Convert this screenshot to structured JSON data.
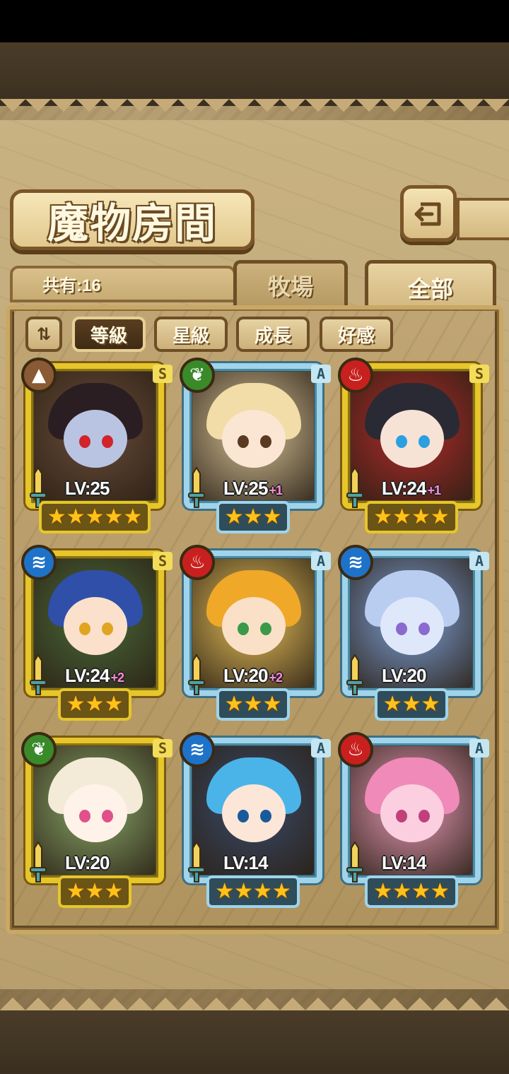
{
  "header": {
    "title": "魔物房間",
    "back_icon": "back-return-icon"
  },
  "collection": {
    "count_label": "共有:16"
  },
  "tabs": [
    {
      "label": "牧場",
      "selected": false
    },
    {
      "label": "全部",
      "selected": true
    }
  ],
  "sort": {
    "toggle_icon": "sort-order-icon",
    "toggle_label": "⇅",
    "options": [
      {
        "label": "等級",
        "active": true
      },
      {
        "label": "星級",
        "active": false
      },
      {
        "label": "成長",
        "active": false
      },
      {
        "label": "好感",
        "active": false
      }
    ]
  },
  "cards": [
    {
      "rank": "S",
      "element": "earth",
      "level": "LV:25",
      "plus": "",
      "stars": "★★★★★",
      "star_count": 5,
      "hair": "#2a1e22",
      "skin": "#b9c4e2",
      "eye": "#d2242a",
      "bg": "#6a4c3a"
    },
    {
      "rank": "A",
      "element": "wind",
      "level": "LV:25",
      "plus": "+1",
      "stars": "★★★",
      "star_count": 3,
      "hair": "#f2dca8",
      "skin": "#fbe6d4",
      "eye": "#5a3a22",
      "bg": "#d8c49a"
    },
    {
      "rank": "S",
      "element": "fire",
      "level": "LV:24",
      "plus": "+1",
      "stars": "★★★★",
      "star_count": 4,
      "hair": "#2a2a34",
      "skin": "#f7e2d6",
      "eye": "#2aa0e0",
      "bg": "#b22a2a"
    },
    {
      "rank": "S",
      "element": "water",
      "level": "LV:24",
      "plus": "+2",
      "stars": "★★★",
      "star_count": 3,
      "hair": "#2f4fa8",
      "skin": "#fbe0cc",
      "eye": "#e0a520",
      "bg": "#4a6a3a"
    },
    {
      "rank": "A",
      "element": "fire",
      "level": "LV:20",
      "plus": "+2",
      "stars": "★★★",
      "star_count": 3,
      "hair": "#f0a828",
      "skin": "#fbe0c8",
      "eye": "#3a9a4a",
      "bg": "#e8c05a"
    },
    {
      "rank": "A",
      "element": "water",
      "level": "LV:20",
      "plus": "",
      "stars": "★★★",
      "star_count": 3,
      "hair": "#b8cdf0",
      "skin": "#dfe8fb",
      "eye": "#8a6ad0",
      "bg": "#7ea0d8"
    },
    {
      "rank": "S",
      "element": "wind",
      "level": "LV:20",
      "plus": "",
      "stars": "★★★",
      "star_count": 3,
      "hair": "#f3ead8",
      "skin": "#fff2e8",
      "eye": "#e0508a",
      "bg": "#8aa86a"
    },
    {
      "rank": "A",
      "element": "water",
      "level": "LV:14",
      "plus": "",
      "stars": "★★★★",
      "star_count": 4,
      "hair": "#4ab4e8",
      "skin": "#fbe6d8",
      "eye": "#1a5a9a",
      "bg": "#3a4a6a"
    },
    {
      "rank": "A",
      "element": "fire",
      "level": "LV:14",
      "plus": "",
      "stars": "★★★★",
      "star_count": 4,
      "hair": "#f08ab8",
      "skin": "#fbcfe0",
      "eye": "#c0407a",
      "bg": "#e89ab8"
    }
  ],
  "element_icons": {
    "earth": {
      "color": "#8a5a34",
      "glyph": "▲",
      "name": "earth-element-icon"
    },
    "wind": {
      "color": "#3a8a2a",
      "glyph": "❦",
      "name": "wind-element-icon"
    },
    "fire": {
      "color": "#c8201e",
      "glyph": "♨",
      "name": "fire-element-icon"
    },
    "water": {
      "color": "#1e72c8",
      "glyph": "≋",
      "name": "water-element-icon"
    }
  }
}
